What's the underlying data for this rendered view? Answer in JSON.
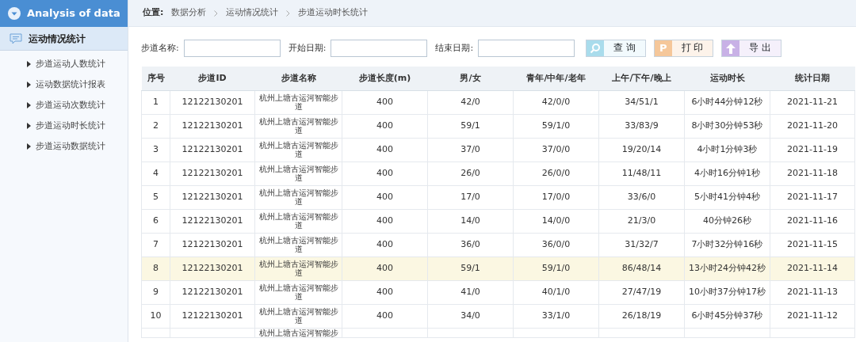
{
  "sidebar": {
    "title": "Analysis of data",
    "section": {
      "label": "运动情况统计"
    },
    "items": [
      {
        "label": "步道运动人数统计",
        "selected": false
      },
      {
        "label": "运动数据统计报表",
        "selected": false
      },
      {
        "label": "步道运动次数统计",
        "selected": false
      },
      {
        "label": "步道运动时长统计",
        "selected": false
      },
      {
        "label": "步道运动数据统计",
        "selected": false
      }
    ]
  },
  "breadcrumb": {
    "label": "位置:",
    "items": [
      "数据分析",
      "运动情况统计",
      "步道运动时长统计"
    ]
  },
  "filters": [
    {
      "label": "步道名称:"
    },
    {
      "label": "开始日期:"
    },
    {
      "label": "结束日期:"
    }
  ],
  "buttons": [
    {
      "label": "查 询",
      "kind": "search"
    },
    {
      "label": "打 印",
      "kind": "print",
      "glyph": "P"
    },
    {
      "label": "导 出",
      "kind": "export"
    }
  ],
  "table": {
    "columns": [
      "序号",
      "步道ID",
      "步道名称",
      "步道长度(m)",
      "男/女",
      "青年/中年/老年",
      "上午/下午/晚上",
      "运动时长",
      "统计日期"
    ],
    "rows": [
      {
        "selected": false,
        "cells": [
          "1",
          "12122130201",
          "杭州上塘古运河智能步道",
          "400",
          "42/0",
          "42/0/0",
          "34/51/1",
          "6小时44分钟12秒",
          "2021-11-21"
        ]
      },
      {
        "selected": false,
        "cells": [
          "2",
          "12122130201",
          "杭州上塘古运河智能步道",
          "400",
          "59/1",
          "59/1/0",
          "33/83/9",
          "8小时30分钟53秒",
          "2021-11-20"
        ]
      },
      {
        "selected": false,
        "cells": [
          "3",
          "12122130201",
          "杭州上塘古运河智能步道",
          "400",
          "37/0",
          "37/0/0",
          "19/20/14",
          "4小时1分钟3秒",
          "2021-11-19"
        ]
      },
      {
        "selected": false,
        "cells": [
          "4",
          "12122130201",
          "杭州上塘古运河智能步道",
          "400",
          "26/0",
          "26/0/0",
          "11/48/11",
          "4小时16分钟1秒",
          "2021-11-18"
        ]
      },
      {
        "selected": false,
        "cells": [
          "5",
          "12122130201",
          "杭州上塘古运河智能步道",
          "400",
          "17/0",
          "17/0/0",
          "33/6/0",
          "5小时41分钟4秒",
          "2021-11-17"
        ]
      },
      {
        "selected": false,
        "cells": [
          "6",
          "12122130201",
          "杭州上塘古运河智能步道",
          "400",
          "14/0",
          "14/0/0",
          "21/3/0",
          "40分钟26秒",
          "2021-11-16"
        ]
      },
      {
        "selected": false,
        "cells": [
          "7",
          "12122130201",
          "杭州上塘古运河智能步道",
          "400",
          "36/0",
          "36/0/0",
          "31/32/7",
          "7小时32分钟16秒",
          "2021-11-15"
        ]
      },
      {
        "selected": true,
        "cells": [
          "8",
          "12122130201",
          "杭州上塘古运河智能步道",
          "400",
          "59/1",
          "59/1/0",
          "86/48/14",
          "13小时24分钟42秒",
          "2021-11-14"
        ]
      },
      {
        "selected": false,
        "cells": [
          "9",
          "12122130201",
          "杭州上塘古运河智能步道",
          "400",
          "41/0",
          "40/1/0",
          "27/47/19",
          "10小时37分钟17秒",
          "2021-11-13"
        ]
      },
      {
        "selected": false,
        "cells": [
          "10",
          "12122130201",
          "杭州上塘古运河智能步道",
          "400",
          "34/0",
          "33/1/0",
          "26/18/19",
          "6小时45分钟37秒",
          "2021-11-12"
        ]
      },
      {
        "selected": false,
        "partial": true,
        "cells": [
          "",
          "",
          "杭州上塘古运河智能步",
          "",
          "",
          "",
          "",
          "",
          ""
        ]
      }
    ]
  }
}
